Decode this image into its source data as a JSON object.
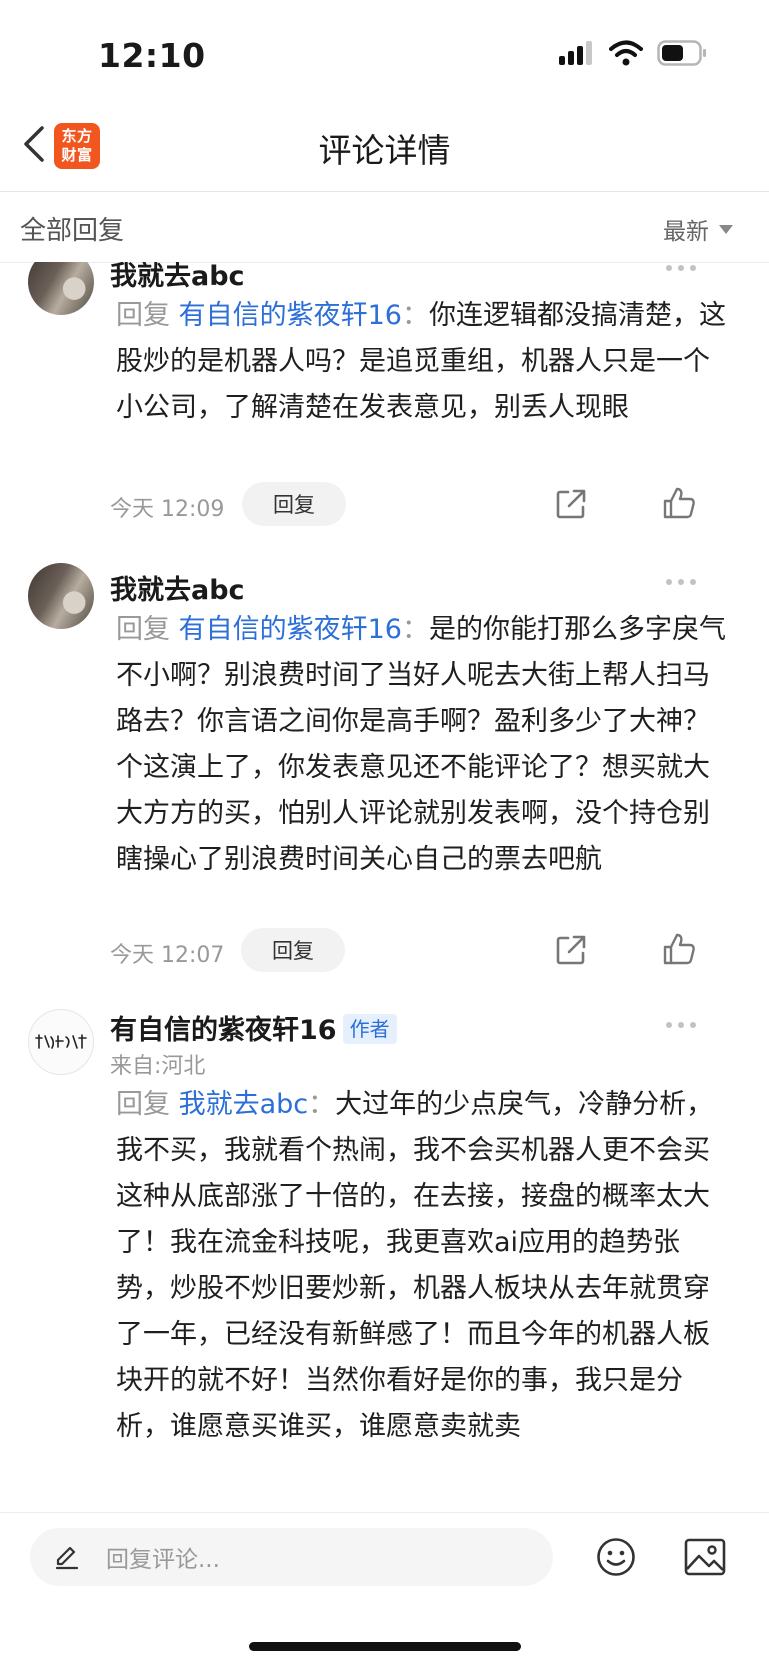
{
  "status_bar": {
    "time": "12:10"
  },
  "nav": {
    "logo_line1": "东方",
    "logo_line2": "财富",
    "title": "评论详情"
  },
  "filter": {
    "label": "全部回复",
    "sort": "最新"
  },
  "comments": [
    {
      "username": "我就去abc",
      "reply_prefix": "回复",
      "reply_target": "有自信的紫夜轩16",
      "reply_colon": "：",
      "text": "你连逻辑都没搞清楚，这股炒的是机器人吗？是追觅重组，机器人只是一个小公司，了解清楚在发表意见，别丢人现眼",
      "time": "今天 12:09",
      "reply_label": "回复"
    },
    {
      "username": "我就去abc",
      "reply_prefix": "回复",
      "reply_target": "有自信的紫夜轩16",
      "reply_colon": "：",
      "text": "是的你能打那么多字戾气不小啊？别浪费时间了当好人呢去大街上帮人扫马路去？你言语之间你是高手啊？盈利多少了大神？个这演上了，你发表意见还不能评论了？想买就大大方方的买，怕别人评论就别发表啊，没个持仓别瞎操心了别浪费时间关心自己的票去吧航",
      "time": "今天 12:07",
      "reply_label": "回复"
    },
    {
      "username": "有自信的紫夜轩16",
      "badge": "作者",
      "from": "来自:河北",
      "reply_prefix": "回复",
      "reply_target": "我就去abc",
      "reply_colon": "：",
      "text": "大过年的少点戾气，冷静分析，我不买，我就看个热闹，我不会买机器人更不会买这种从底部涨了十倍的，在去接，接盘的概率太大了！我在流金科技呢，我更喜欢ai应用的趋势张势，炒股不炒旧要炒新，机器人板块从去年就贯穿了一年，已经没有新鲜感了！而且今年的机器人板块开的就不好！当然你看好是你的事，我只是分析，谁愿意买谁买，谁愿意卖就卖"
    }
  ],
  "bottom_bar": {
    "placeholder": "回复评论..."
  },
  "colors": {
    "brand": "#f2561f",
    "link": "#2c6fd8",
    "muted": "#999999"
  }
}
